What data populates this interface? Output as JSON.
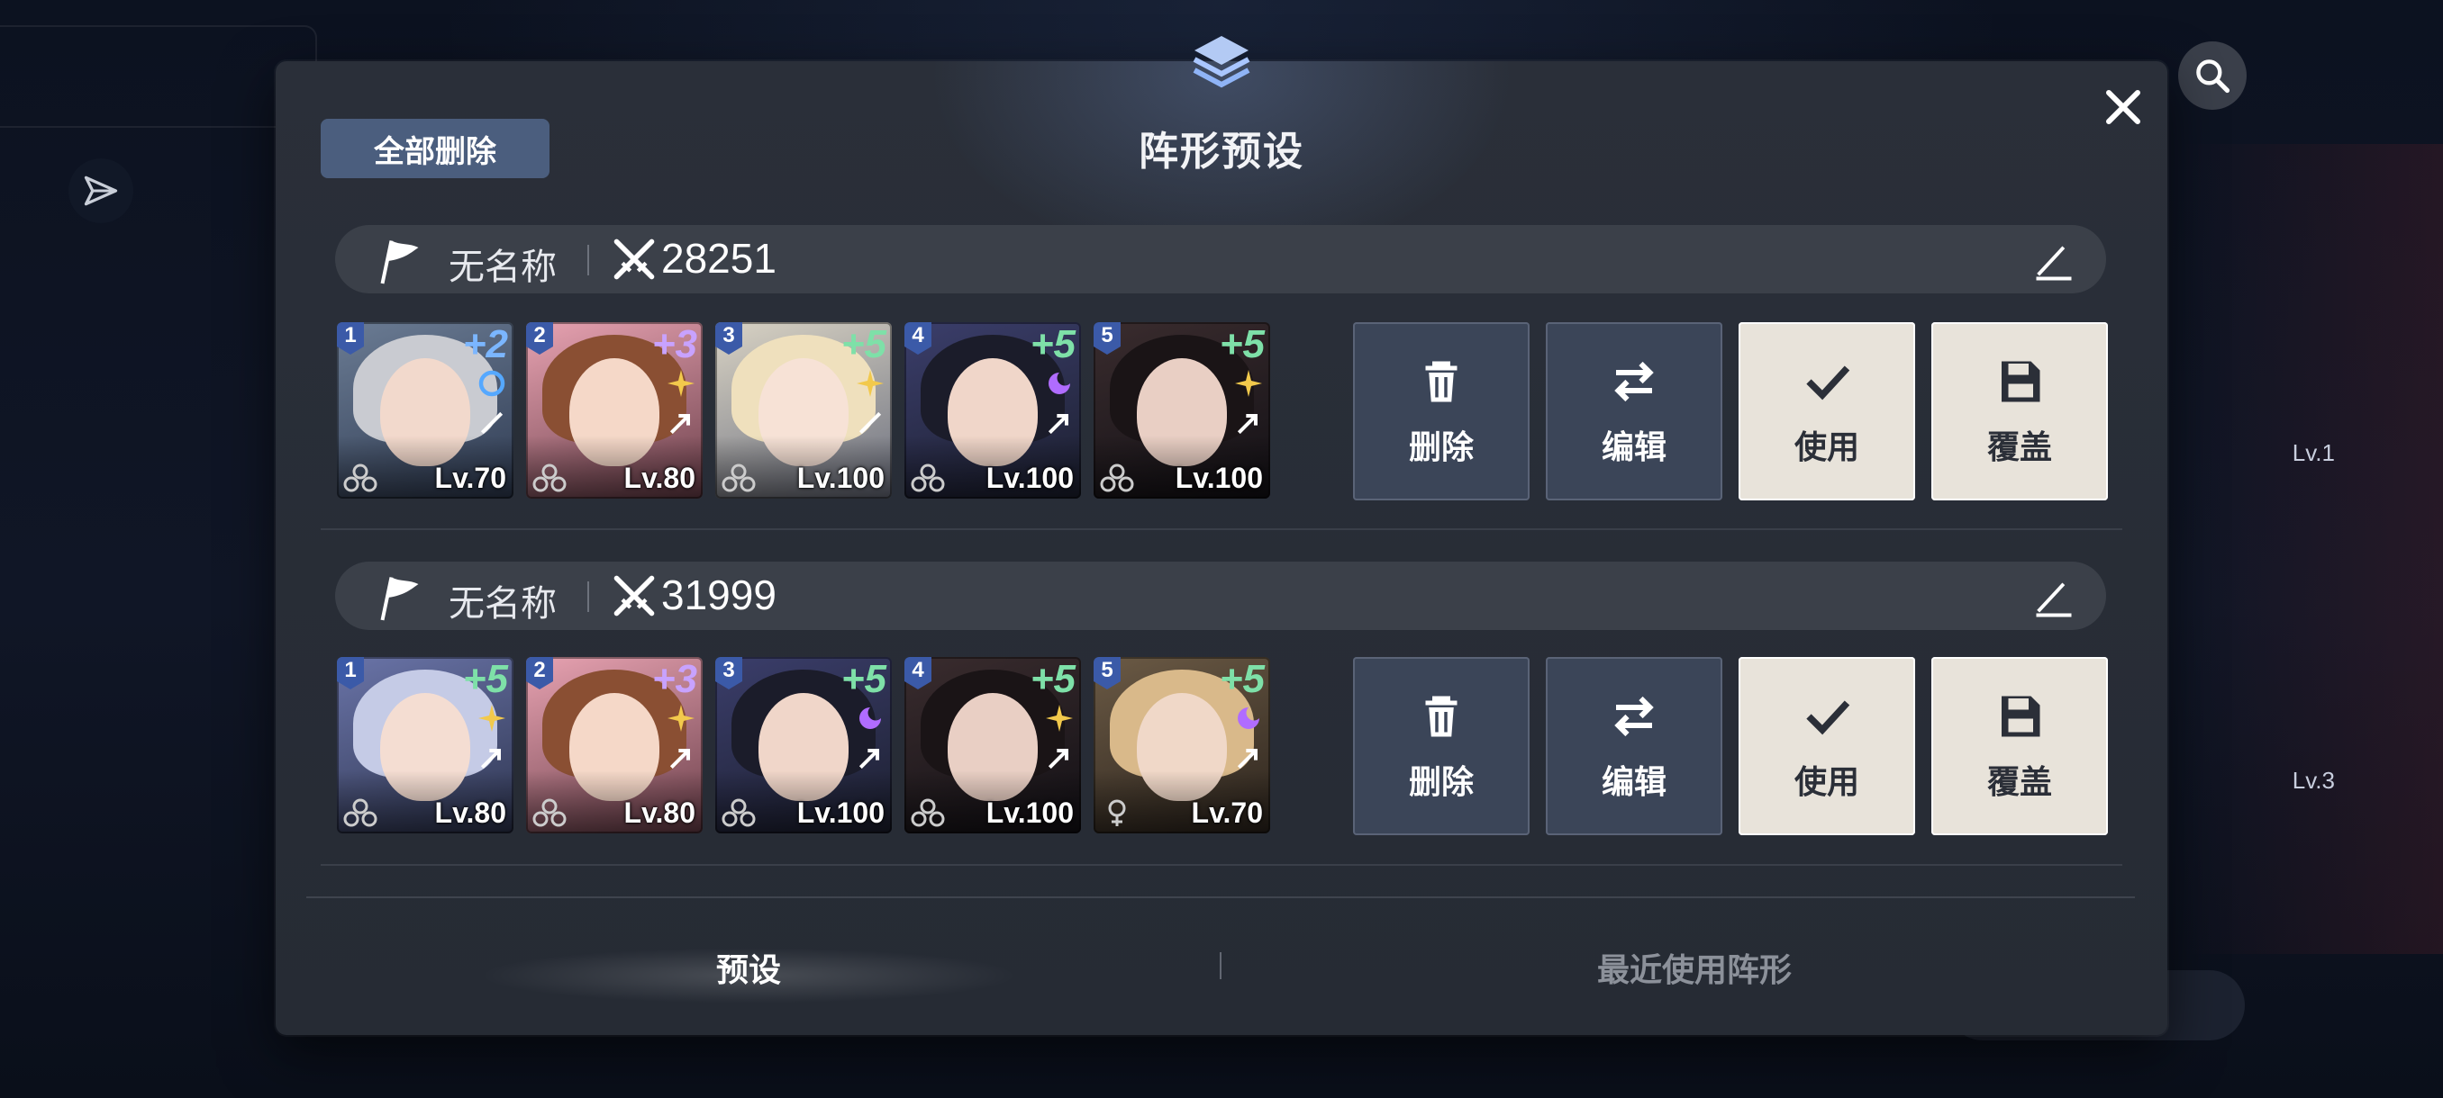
{
  "panel": {
    "title": "阵形预设",
    "delete_all_label": "全部删除"
  },
  "presets": [
    {
      "name": "无名称",
      "power": "28251",
      "units": [
        {
          "slot": "1",
          "plus": "+2",
          "level": "Lv.70",
          "plus_color": "#7bb6ff"
        },
        {
          "slot": "2",
          "plus": "+3",
          "level": "Lv.80",
          "plus_color": "#c8a2ff"
        },
        {
          "slot": "3",
          "plus": "+5",
          "level": "Lv.100",
          "plus_color": "#7ee0a8"
        },
        {
          "slot": "4",
          "plus": "+5",
          "level": "Lv.100",
          "plus_color": "#7ee0a8"
        },
        {
          "slot": "5",
          "plus": "+5",
          "level": "Lv.100",
          "plus_color": "#7ee0a8"
        }
      ],
      "actions": {
        "delete": "删除",
        "edit": "编辑",
        "use": "使用",
        "overwrite": "覆盖"
      }
    },
    {
      "name": "无名称",
      "power": "31999",
      "units": [
        {
          "slot": "1",
          "plus": "+5",
          "level": "Lv.80",
          "plus_color": "#7ee0a8"
        },
        {
          "slot": "2",
          "plus": "+3",
          "level": "Lv.80",
          "plus_color": "#c8a2ff"
        },
        {
          "slot": "3",
          "plus": "+5",
          "level": "Lv.100",
          "plus_color": "#7ee0a8"
        },
        {
          "slot": "4",
          "plus": "+5",
          "level": "Lv.100",
          "plus_color": "#7ee0a8"
        },
        {
          "slot": "5",
          "plus": "+5",
          "level": "Lv.70",
          "plus_color": "#7ee0a8"
        }
      ],
      "actions": {
        "delete": "删除",
        "edit": "编辑",
        "use": "使用",
        "overwrite": "覆盖"
      }
    }
  ],
  "tabs": {
    "preset": "预设",
    "recent": "最近使用阵形"
  },
  "background": {
    "lv_a": "Lv.1",
    "lv_b": "Lv.3"
  }
}
